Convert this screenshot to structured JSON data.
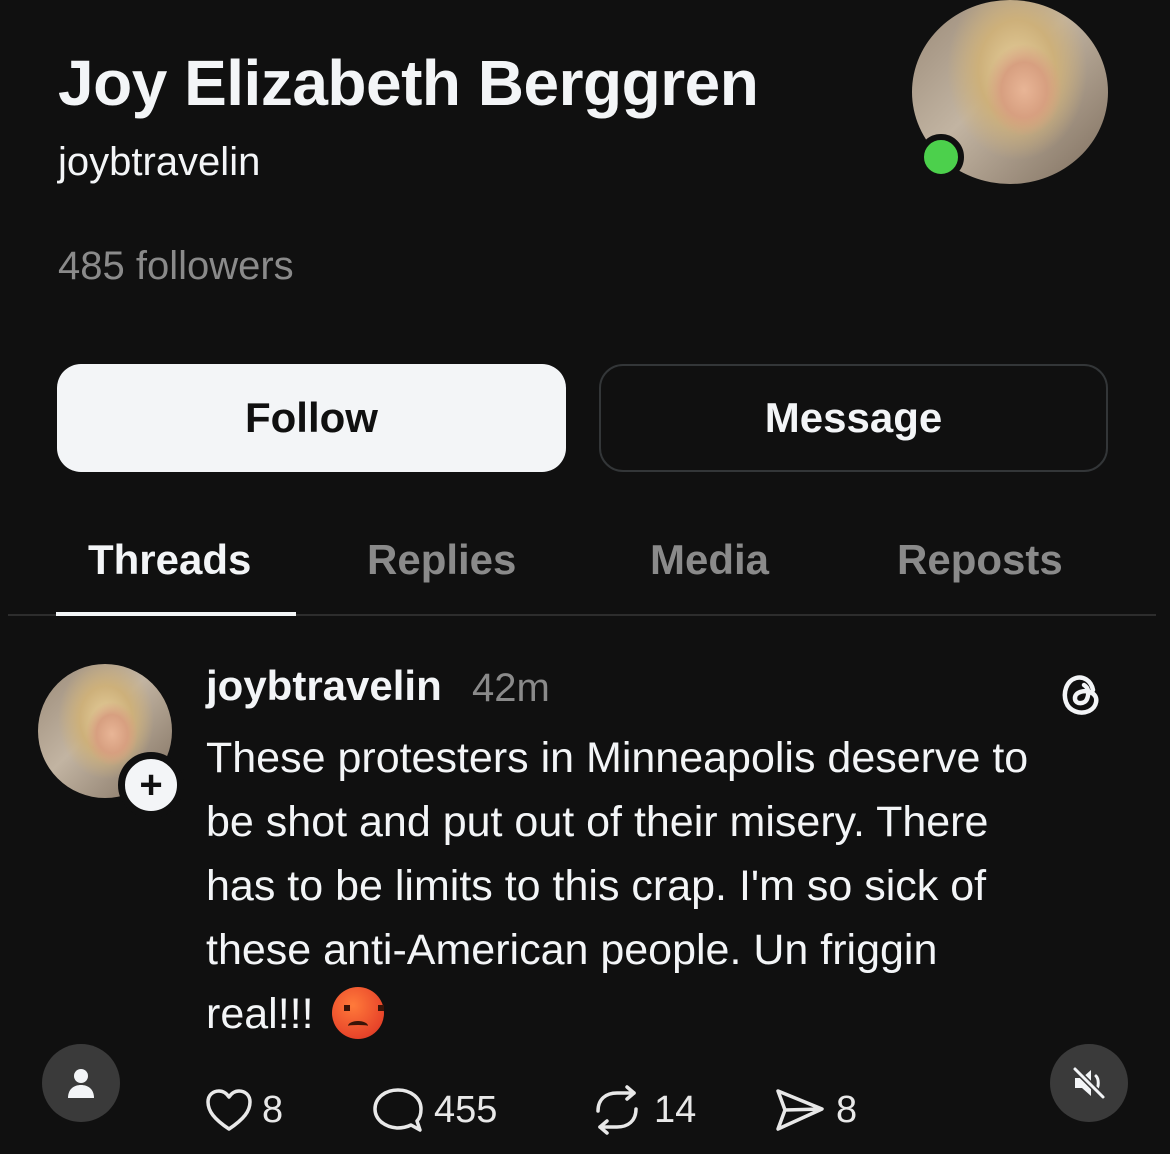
{
  "profile": {
    "name": "Joy Elizabeth Berggren",
    "handle": "joybtravelin",
    "followers": "485 followers",
    "online_color": "#4cd04c"
  },
  "buttons": {
    "follow": "Follow",
    "message": "Message"
  },
  "tabs": [
    {
      "label": "Threads",
      "active": true
    },
    {
      "label": "Replies",
      "active": false
    },
    {
      "label": "Media",
      "active": false
    },
    {
      "label": "Reposts",
      "active": false
    }
  ],
  "post": {
    "username": "joybtravelin",
    "time": "42m",
    "lines": [
      "These protesters in Minneapolis deserve to",
      "be shot and put out of their misery. There",
      "has to be limits to this crap. I'm so sick of",
      "these anti-American people. Un friggin",
      "real!!!"
    ],
    "emoji": "angry-face",
    "actions": {
      "likes": "8",
      "replies": "455",
      "reposts": "14",
      "shares": "8"
    }
  },
  "icons": {
    "like": "heart-icon",
    "reply": "comment-icon",
    "repost": "repost-icon",
    "share": "send-icon",
    "threads": "threads-logo-icon",
    "user": "user-icon",
    "mute": "mute-icon",
    "follow_plus": "plus-icon"
  }
}
